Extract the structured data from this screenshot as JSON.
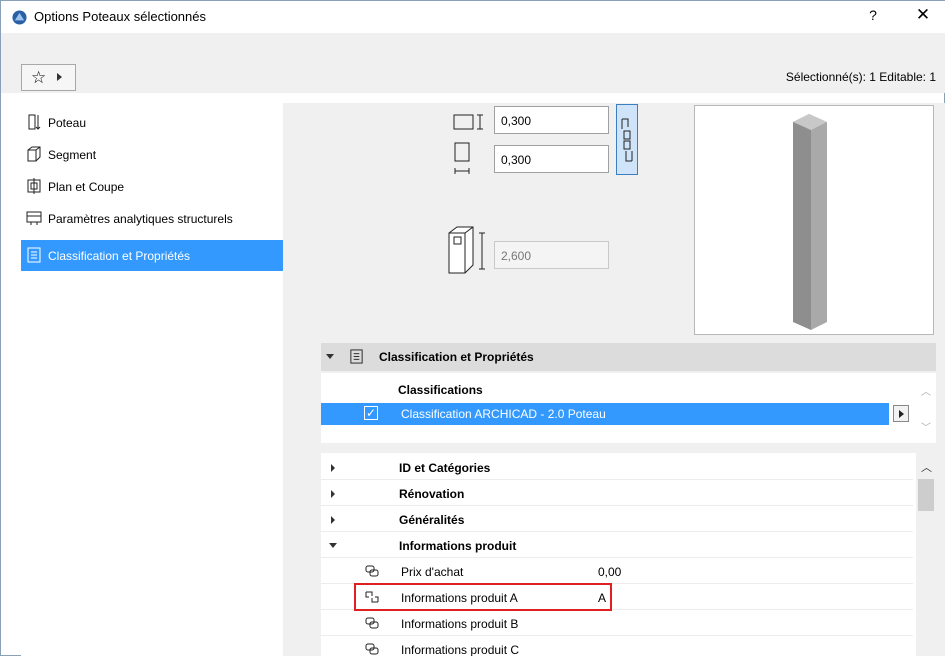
{
  "window": {
    "title": "Options Poteaux sélectionnés",
    "help_label": "?",
    "close_label": "✕"
  },
  "toolbar": {
    "favorites_icon": "star-icon",
    "selection_info": "Sélectionné(s): 1 Editable: 1"
  },
  "panels": [
    {
      "label": "Poteau",
      "icon": "column-icon",
      "active": false
    },
    {
      "label": "Segment",
      "icon": "segment-icon",
      "active": false
    },
    {
      "label": "Plan et Coupe",
      "icon": "plan-section-icon",
      "active": false
    },
    {
      "label": "Paramètres analytiques structurels",
      "icon": "structural-analytics-icon",
      "active": false
    },
    {
      "label": "Classification et Propriétés",
      "icon": "classification-icon",
      "active": true
    }
  ],
  "dimensions": {
    "width": "0,300",
    "depth": "0,300",
    "height": "2,600"
  },
  "section": {
    "title": "Classification et Propriétés"
  },
  "classifications": {
    "header": "Classifications",
    "rows": [
      {
        "label": "Classification ARCHICAD - 2.0 Poteau",
        "checked": true,
        "check_mark": "✓"
      }
    ]
  },
  "property_groups": [
    {
      "label": "ID et Catégories",
      "expanded": false
    },
    {
      "label": "Rénovation",
      "expanded": false
    },
    {
      "label": "Généralités",
      "expanded": false
    },
    {
      "label": "Informations produit",
      "expanded": true
    }
  ],
  "properties": [
    {
      "name": "Prix d'achat",
      "value": "0,00",
      "icon": "linked-property-icon"
    },
    {
      "name": "Informations produit A",
      "value": "A",
      "icon": "unlinked-property-icon"
    },
    {
      "name": "Informations produit B",
      "value": "",
      "icon": "linked-property-icon"
    },
    {
      "name": "Informations produit C",
      "value": "",
      "icon": "linked-property-icon"
    }
  ],
  "colors": {
    "accent": "#3399ff",
    "highlight_border": "#e02020",
    "panel_bg": "#f0f0f0"
  }
}
